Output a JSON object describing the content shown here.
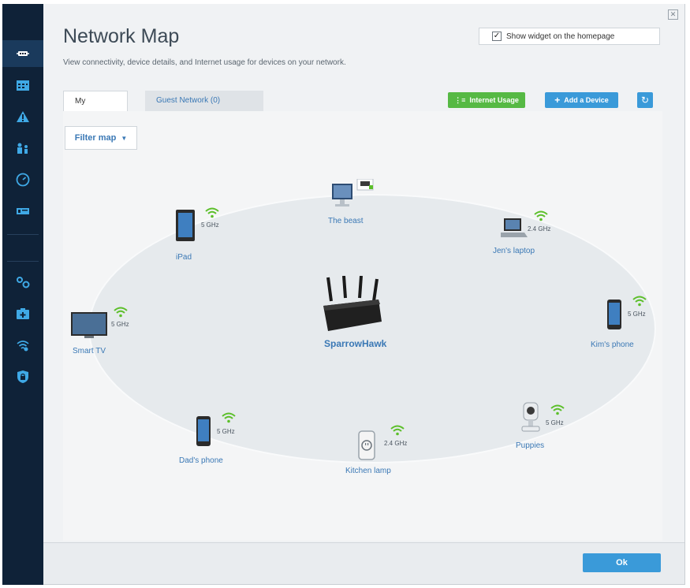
{
  "header": {
    "title": "Network Map",
    "subtitle": "View connectivity, device details, and Internet usage for devices on your network.",
    "widget_label": "Show widget on the homepage",
    "widget_checked": true,
    "close_icon": "close-icon"
  },
  "sidebar": {
    "items": [
      {
        "icon": "network-map-icon",
        "active": true
      },
      {
        "icon": "calendar-icon",
        "active": false
      },
      {
        "icon": "warning-icon",
        "active": false
      },
      {
        "icon": "parental-controls-icon",
        "active": false
      },
      {
        "icon": "speed-test-icon",
        "active": false
      },
      {
        "icon": "usb-storage-icon",
        "active": false
      },
      {
        "icon": "settings-icon",
        "active": false
      },
      {
        "icon": "troubleshooting-icon",
        "active": false
      },
      {
        "icon": "wireless-icon",
        "active": false
      },
      {
        "icon": "security-icon",
        "active": false
      }
    ]
  },
  "tabs": [
    {
      "label": "My Network",
      "active": true
    },
    {
      "label": "Guest Network (0)",
      "active": false
    }
  ],
  "toolbar": {
    "internet_usage_label": "Internet Usage",
    "add_device_label": "Add a Device",
    "refresh_icon": "refresh-icon"
  },
  "filter": {
    "label": "Filter map"
  },
  "router": {
    "name": "SparrowHawk"
  },
  "devices": [
    {
      "name": "The beast",
      "band": "",
      "type": "desktop",
      "wired": true
    },
    {
      "name": "iPad",
      "band": "5 GHz",
      "type": "tablet"
    },
    {
      "name": "Jen's laptop",
      "band": "2.4 GHz",
      "type": "laptop"
    },
    {
      "name": "Smart TV",
      "band": "5 GHz",
      "type": "tv"
    },
    {
      "name": "Kim's phone",
      "band": "5 GHz",
      "type": "phone"
    },
    {
      "name": "Dad's phone",
      "band": "5 GHz",
      "type": "phone"
    },
    {
      "name": "Kitchen lamp",
      "band": "2.4 GHz",
      "type": "smart-plug"
    },
    {
      "name": "Puppies",
      "band": "5 GHz",
      "type": "camera"
    }
  ],
  "footer": {
    "ok_label": "Ok"
  },
  "colors": {
    "sidebar_bg": "#0f2238",
    "accent_blue": "#3a9ad9",
    "accent_green": "#56b944",
    "wifi_green": "#5cbf2a",
    "link_blue": "#3a78b5"
  }
}
